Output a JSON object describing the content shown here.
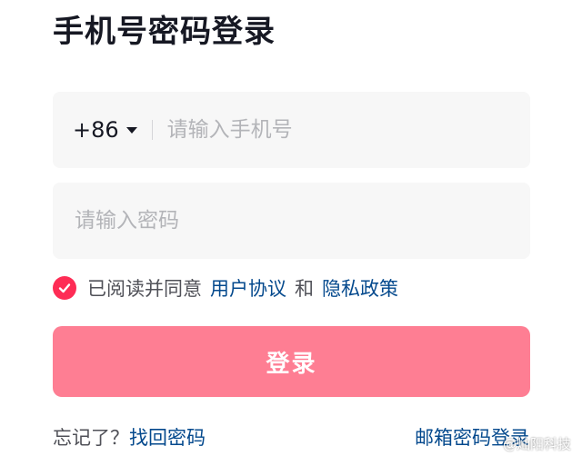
{
  "page": {
    "title": "手机号密码登录"
  },
  "phone_field": {
    "country_code": "+86",
    "placeholder": "请输入手机号",
    "value": ""
  },
  "password_field": {
    "placeholder": "请输入密码",
    "value": ""
  },
  "agreement": {
    "checked": true,
    "prefix": "已阅读并同意",
    "user_agreement_link": "用户协议",
    "and": "和",
    "privacy_policy_link": "隐私政策"
  },
  "login_button": {
    "label": "登录"
  },
  "footer": {
    "forgot_prefix": "忘记了？",
    "recover_password_link": "找回密码",
    "email_login_link": "邮箱密码登录"
  },
  "watermark": {
    "text": "@灿阳科技"
  },
  "icons": {
    "dropdown": "caret-down-icon",
    "checkbox": "check-icon"
  },
  "colors": {
    "accent": "#fe2c55",
    "button_disabled": "#fe7e93",
    "link": "#04498d",
    "field_bg": "#f7f7f7",
    "text_primary": "#161823",
    "text_secondary": "#505158",
    "placeholder": "#b3b4b8"
  }
}
